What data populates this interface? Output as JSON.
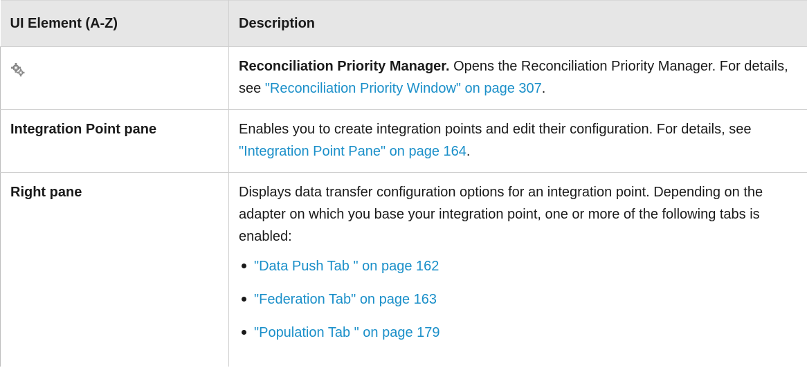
{
  "table": {
    "headers": [
      "UI Element (A-Z)",
      "Description"
    ],
    "rows": [
      {
        "icon": "reconciliation-priority-manager-icon",
        "title": "Reconciliation Priority Manager.",
        "text": " Opens the Reconciliation Priority Manager. For details, see ",
        "link": "\"Reconciliation Priority Window\" on page 307",
        "after": "."
      },
      {
        "element": "Integration Point pane",
        "text": "Enables you to create integration points and edit their configuration. For details, see ",
        "link": "\"Integration Point Pane\" on page 164",
        "after": "."
      },
      {
        "element": "Right pane",
        "text": "Displays data transfer configuration options for an integration point. Depending on the adapter on which you base your integration point, one or more of the following tabs is enabled:",
        "tabs": [
          "\"Data Push Tab \" on page 162",
          "\"Federation Tab\" on page 163",
          "\"Population Tab \" on page 179"
        ]
      }
    ]
  },
  "colors": {
    "link": "#1a8fc9",
    "header_bg": "#e6e6e6",
    "border": "#cfcfcf"
  }
}
